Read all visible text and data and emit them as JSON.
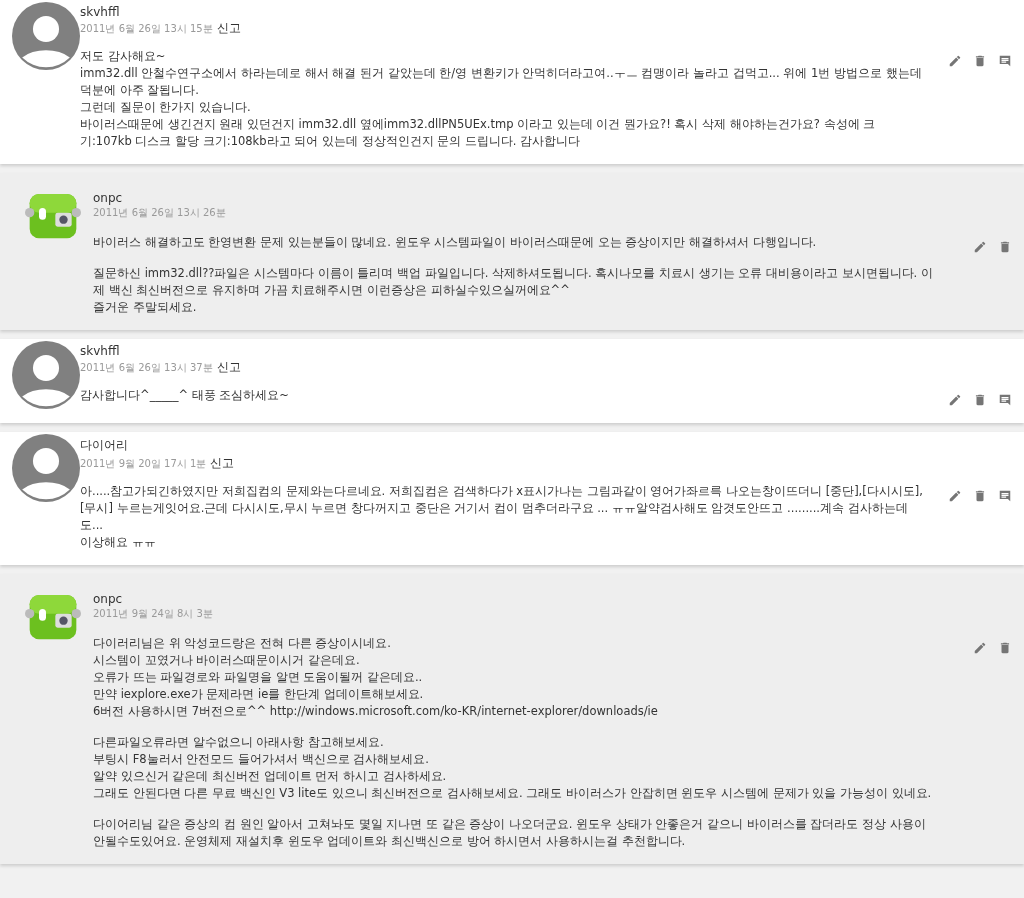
{
  "comments": [
    {
      "kind": "comment",
      "author": "skvhffl",
      "date": "2011년 6월 26일 13시 15분",
      "report": "신고",
      "paragraphs": [
        "저도 감사해요~\nimm32.dll 안철수연구소에서 하라는데로 해서 해결 된거 같았는데 한/영 변환키가 안먹히더라고여..ㅜㅡ 컴맹이라 놀라고 겁먹고... 위에 1번 방법으로 했는데 덕분에 아주 잘됩니다.\n그런데 질문이 한가지 있습니다.\n바이러스때문에 생긴건지 원래 있던건지 imm32.dll 옆에imm32.dllPN5UEx.tmp 이라고 있는데 이건 뭔가요?! 혹시 삭제 해야하는건가요? 속성에 크기:107kb 디스크 할당 크기:108kb라고 되어 있는데 정상적인건지 문의 드립니다. 감사합니다"
      ]
    },
    {
      "kind": "reply",
      "author": "onpc",
      "date": "2011년 6월 26일 13시 26분",
      "paragraphs": [
        "바이러스 해결하고도 한영변환 문제 있는분들이 많네요. 윈도우 시스템파일이 바이러스때문에 오는 증상이지만 해결하셔서 다행입니다.",
        "질문하신 imm32.dll??파일은 시스템마다 이름이 틀리며 백업 파일입니다. 삭제하셔도됩니다. 혹시나모를 치료시 생기는 오류 대비용이라고 보시면됩니다. 이제 백신 최신버전으로 유지하며 가끔 치료해주시면 이런증상은 피하실수있으실꺼에요^^\n즐거운 주말되세요."
      ]
    },
    {
      "kind": "comment",
      "author": "skvhffl",
      "date": "2011년 6월 26일 13시 37분",
      "report": "신고",
      "paragraphs": [
        "감사합니다^_____^ 태풍 조심하세요~"
      ]
    },
    {
      "kind": "comment",
      "author": "다이어리",
      "date": "2011년 9월 20일 17시 1분",
      "report": "신고",
      "paragraphs": [
        "아.....참고가되긴하였지만 저희집컴의 문제와는다르네요. 저희집컴은 검색하다가 x표시가나는 그림과같이 영어가좌르륵 나오는창이뜨더니 [중단],[다시시도],[무시] 누르는게잇어요.근데 다시시도,무시 누르면 창다꺼지고 중단은 거기서 컴이 멈추더라구요 ... ㅠㅠ알약검사해도 암겻도안뜨고 .........계속 검사하는데도...\n이상해요 ㅠㅠ"
      ]
    },
    {
      "kind": "reply",
      "author": "onpc",
      "date": "2011년 9월 24일 8시 3분",
      "paragraphs": [
        "다이러리님은 위 악성코드랑은 전혀 다른 증상이시네요.\n시스템이 꼬였거나 바이러스때문이시거 같은데요.\n오류가 뜨는 파일경로와 파일명을 알면 도움이될꺼 같은데요..\n만약 iexplore.exe가 문제라면 ie를 한단계 업데이트해보세요.\n6버전 사용하시면 7버전으로^^ http://windows.microsoft.com/ko-KR/internet-explorer/downloads/ie",
        "다른파일오류라면 알수없으니 아래사항 참고해보세요.\n부팅시 F8눌러서 안전모드 들어가셔서 백신으로 검사해보세요.\n알약 있으신거 같은데 최신버전 업데이트 먼저 하시고 검사하세요.\n그래도 안된다면 다른 무료 백신인 V3 lite도 있으니 최신버전으로 검사해보세요. 그래도 바이러스가 안잡히면 윈도우 시스템에 문제가 있을 가능성이 있네요.",
        "다이어리님 같은 증상의 컴 원인 알아서 고쳐놔도 몇일 지나면 또 같은 증상이 나오더군요. 윈도우 상태가 안좋은거 같으니 바이러스를 잡더라도 정상 사용이 안될수도있어요. 운영체제 재설치후 윈도우 업데이트와 최신백신으로 방어 하시면서 사용하시는걸 추천합니다."
      ]
    }
  ]
}
